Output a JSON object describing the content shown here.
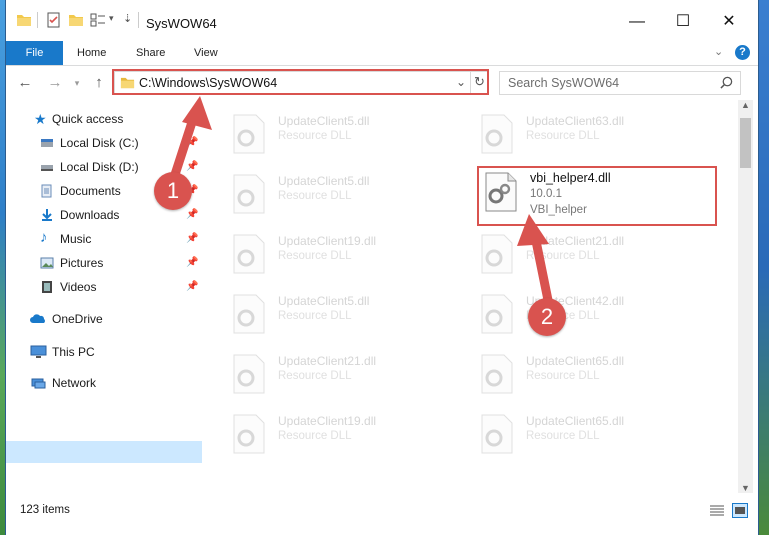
{
  "window": {
    "title": "SysWOW64"
  },
  "ribbon": {
    "file": "File",
    "home": "Home",
    "share": "Share",
    "view": "View"
  },
  "address": {
    "path": "C:\\Windows\\SysWOW64"
  },
  "search": {
    "placeholder": "Search SysWOW64"
  },
  "sidebar": {
    "items": [
      {
        "label": "Quick access"
      },
      {
        "label": "Local Disk (C:)"
      },
      {
        "label": "Local Disk (D:)"
      },
      {
        "label": "Documents"
      },
      {
        "label": "Downloads"
      },
      {
        "label": "Music"
      },
      {
        "label": "Pictures"
      },
      {
        "label": "Videos"
      },
      {
        "label": "OneDrive"
      },
      {
        "label": "This PC"
      },
      {
        "label": "Network"
      }
    ]
  },
  "files": {
    "left": [
      {
        "name": "UpdateClient5.dll",
        "type": "Resource DLL"
      },
      {
        "name": "UpdateClient5.dll",
        "type": "Resource DLL"
      },
      {
        "name": "UpdateClient19.dll",
        "type": "Resource DLL"
      },
      {
        "name": "UpdateClient5.dll",
        "type": "Resource DLL"
      },
      {
        "name": "UpdateClient21.dll",
        "type": "Resource DLL"
      },
      {
        "name": "UpdateClient19.dll",
        "type": "Resource DLL"
      }
    ],
    "right": [
      {
        "name": "UpdateClient63.dll",
        "type": "Resource DLL"
      },
      {
        "name": "UpdateClient21.dll",
        "type": "Resource DLL"
      },
      {
        "name": "UpdateClient42.dll",
        "type": "Resource DLL"
      },
      {
        "name": "UpdateClient65.dll",
        "type": "Resource DLL"
      },
      {
        "name": "UpdateClient65.dll",
        "type": "Resource DLL"
      }
    ],
    "highlighted": {
      "name": "vbi_helper4.dll",
      "version": "10.0.1",
      "description": "VBI_helper"
    }
  },
  "annotations": {
    "step1": "1",
    "step2": "2"
  },
  "status": {
    "count": "123 items"
  },
  "colors": {
    "accent": "#1979ca",
    "highlight": "#d9534f",
    "selection": "#cce8ff"
  }
}
